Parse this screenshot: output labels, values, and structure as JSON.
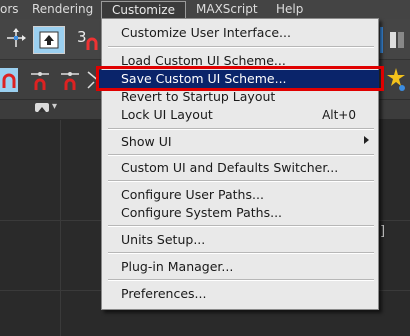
{
  "menubar": {
    "items": [
      "ors",
      "Rendering",
      "Customize",
      "MAXScript",
      "Help"
    ]
  },
  "toolbar": {
    "count_label": "3",
    "small_dropdown": "▾"
  },
  "viewport": {
    "bracket": "]"
  },
  "customize_menu": {
    "items": [
      "Customize User Interface...",
      "Load Custom UI Scheme...",
      "Save Custom UI Scheme...",
      "Revert to Startup Layout",
      "Lock UI Layout",
      "Show UI",
      "Custom UI and Defaults Switcher...",
      "Configure User Paths...",
      "Configure System Paths...",
      "Units Setup...",
      "Plug-in Manager...",
      "Preferences..."
    ],
    "lock_shortcut": "Alt+0",
    "highlighted_index": 2
  },
  "colors": {
    "highlight": "#0a246a",
    "annotation_box": "#e00000",
    "menu_bg": "#e9e9e9"
  }
}
